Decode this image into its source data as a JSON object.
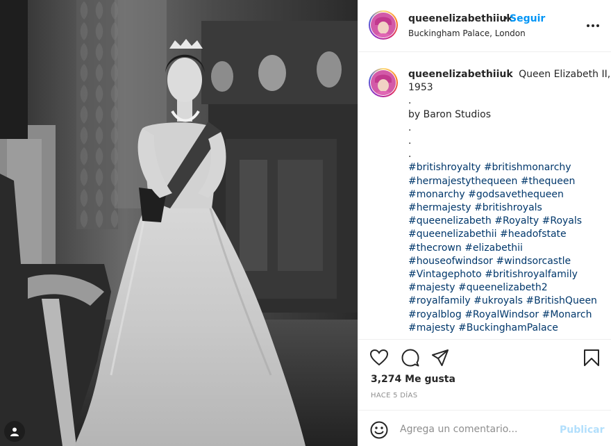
{
  "photo": {
    "alt": "Queen Elizabeth II in a white ball gown, black and white portrait",
    "tag_icon": "user-tag-icon"
  },
  "post": {
    "username": "queenelizabethiiuk",
    "follow_label": "Seguir",
    "separator": "•",
    "location": "Buckingham Palace, London",
    "more_icon": "more-options-icon"
  },
  "caption": {
    "username": "queenelizabethiiuk",
    "title_line1": "Queen Elizabeth II,",
    "title_line2": "1953",
    "dot1": ".",
    "credit": "by Baron Studios",
    "dot2": ".",
    "dot3": ".",
    "dot4": ".",
    "hashtag_lines": [
      [
        "#britishroyalty",
        "#britishmonarchy"
      ],
      [
        "#hermajestythequeen",
        "#thequeen"
      ],
      [
        "#monarchy",
        "#godsavethequeen"
      ],
      [
        "#hermajesty",
        "#britishroyals"
      ],
      [
        "#queenelizabeth",
        "#Royalty",
        "#Royals"
      ],
      [
        "#queenelizabethii",
        "#headofstate"
      ],
      [
        "#thecrown",
        "#elizabethii"
      ],
      [
        "#houseofwindsor",
        "#windsorcastle"
      ],
      [
        "#Vintagephoto",
        "#britishroyalfamily"
      ],
      [
        "#majesty",
        "#queenelizabeth2"
      ],
      [
        "#royalfamily",
        "#ukroyals",
        "#BritishQueen"
      ],
      [
        "#royalblog",
        "#RoyalWindsor",
        "#Monarch"
      ],
      [
        "#majesty",
        "#BuckinghamPalace"
      ]
    ]
  },
  "actions": {
    "like_icon": "heart-icon",
    "comment_icon": "comment-icon",
    "share_icon": "share-icon",
    "save_icon": "bookmark-icon"
  },
  "likes": "3,274 Me gusta",
  "time_ago": "HACE 5 DÍAS",
  "comment": {
    "emoji_icon": "emoji-icon",
    "placeholder": "Agrega un comentario...",
    "value": "",
    "publish_label": "Publicar"
  },
  "colors": {
    "accent": "#0095f6",
    "hashtag": "#00376b",
    "publish_disabled": "#b2dffc",
    "muted": "#8e8e8e",
    "text": "#262626"
  }
}
